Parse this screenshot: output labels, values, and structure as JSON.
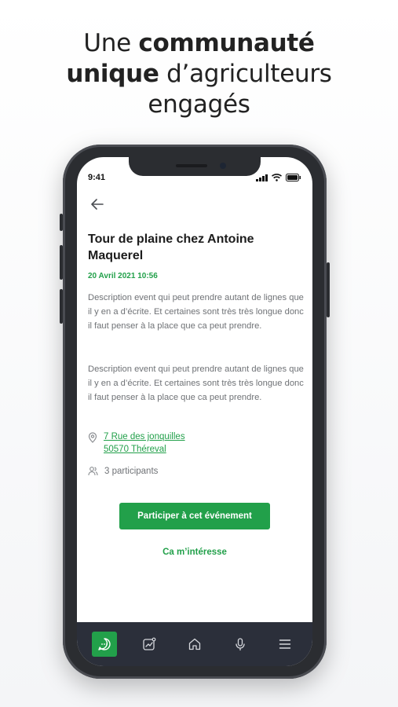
{
  "headline": {
    "line1_prefix": "Une ",
    "line1_bold": "communauté",
    "line2_bold": "unique",
    "line2_rest": " d’agriculteurs",
    "line3": "engagés"
  },
  "status_bar": {
    "time": "9:41"
  },
  "event": {
    "title": "Tour de plaine chez Antoine Maquerel",
    "date": "20 Avril 2021 10:56",
    "description_1": "Description event qui peut prendre autant de lignes que il y en a d’écrite. Et certaines sont très très longue donc il faut penser à la place que ca peut prendre.",
    "description_2": "Description event qui peut prendre autant de lignes que il y en a d’écrite. Et certaines sont très très longue donc il faut penser à la place que ca peut prendre.",
    "address_line1": "7 Rue des jonquilles",
    "address_line2": "50570 Théreval",
    "participants": "3 participants"
  },
  "actions": {
    "participate": "Participer à cet événement",
    "interested": "Ca m’intéresse"
  },
  "tabbar": {
    "items": [
      {
        "icon": "chat-icon",
        "active": true
      },
      {
        "icon": "chart-icon",
        "active": false
      },
      {
        "icon": "home-icon",
        "active": false
      },
      {
        "icon": "microphone-icon",
        "active": false
      },
      {
        "icon": "menu-icon",
        "active": false
      }
    ]
  },
  "colors": {
    "accent": "#22a04a",
    "tabbar": "#2b2f3a",
    "phone": "#2b2d31"
  }
}
